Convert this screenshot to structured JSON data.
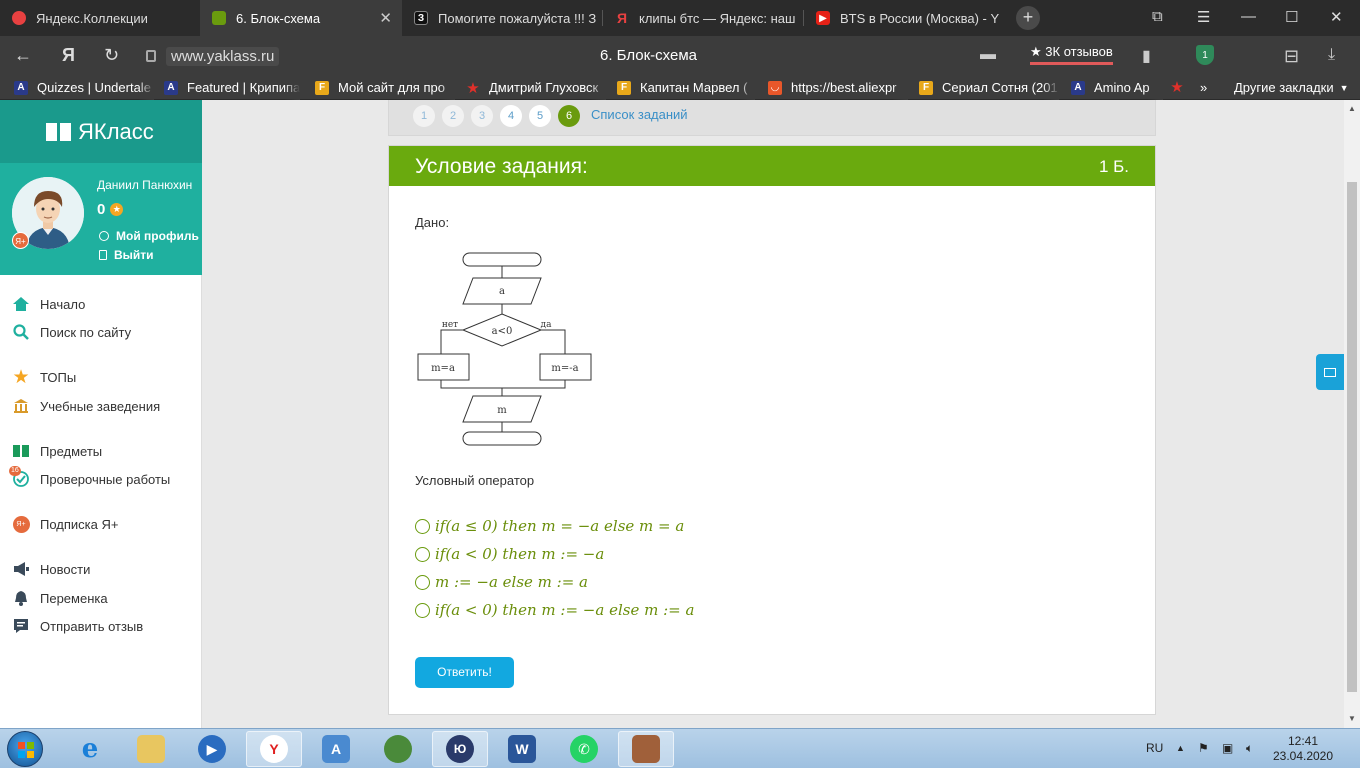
{
  "browser": {
    "tabs": [
      {
        "label": "Яндекс.Коллекции",
        "favicon_color": "#e84141"
      },
      {
        "label": "6. Блок-схема",
        "favicon_color": "#6a9b0e",
        "active": true
      },
      {
        "label": "Помогите пожалуйста !!! З",
        "favicon_text": "З"
      },
      {
        "label": "клипы бтс — Яндекс: наш",
        "favicon_text": "Я"
      },
      {
        "label": "BTS в России (Москва) - Y",
        "favicon_color": "#e62117"
      }
    ],
    "url_host": "www.yaklass.ru",
    "page_title": "6. Блок-схема",
    "reviews_label": "3К отзывов",
    "shield_count": "1",
    "bookmarks": [
      {
        "label": "Quizzes | Undertale",
        "icon": "A"
      },
      {
        "label": "Featured | Крипипа",
        "icon": "A"
      },
      {
        "label": "Мой сайт для про",
        "icon": "F"
      },
      {
        "label": "Дмитрий Глуховск",
        "icon": "star"
      },
      {
        "label": "Капитан Марвел (",
        "icon": "F"
      },
      {
        "label": "https://best.aliexpr",
        "icon": "bag"
      },
      {
        "label": "Сериал Сотня (201",
        "icon": "F"
      },
      {
        "label": "Amino Ap",
        "icon": "A"
      }
    ],
    "other_bookmarks": "Другие закладки"
  },
  "sidebar": {
    "logo": "ЯКласс",
    "user_name": "Даниил Панюхин",
    "points": "0",
    "ya_badge": "Я+",
    "my_profile": "Мой профиль",
    "logout": "Выйти",
    "menu": [
      {
        "label": "Начало",
        "icon": "home-icon"
      },
      {
        "label": "Поиск по сайту",
        "icon": "search-icon"
      },
      {
        "label": "ТОПы",
        "icon": "star-icon"
      },
      {
        "label": "Учебные заведения",
        "icon": "school-icon"
      },
      {
        "label": "Предметы",
        "icon": "book-icon"
      },
      {
        "label": "Проверочные работы",
        "icon": "check-icon",
        "badge": "16"
      },
      {
        "label": "Подписка Я+",
        "icon": "ya-plus-icon"
      },
      {
        "label": "Новости",
        "icon": "megaphone-icon"
      },
      {
        "label": "Переменка",
        "icon": "bell-icon"
      },
      {
        "label": "Отправить отзыв",
        "icon": "feedback-icon"
      }
    ]
  },
  "pager": {
    "pages": [
      "1",
      "2",
      "3",
      "4",
      "5",
      "6"
    ],
    "current": "6",
    "task_list": "Список заданий"
  },
  "task": {
    "title": "Условие задания:",
    "score": "1 Б.",
    "given": "Дано:",
    "flowchart": {
      "input": "a",
      "condition": "a<0",
      "no_label": "нет",
      "yes_label": "да",
      "left_assign": "m=a",
      "right_assign": "m=-a",
      "output": "m"
    },
    "question": "Условный оператор",
    "options": [
      "if(a ≤ 0) then m = −a  else m = a",
      "if(a < 0) then m := −a",
      "m := −a  else m := a",
      "if(a < 0) then m := −a  else m := a"
    ],
    "answer_button": "Ответить!"
  },
  "taskbar": {
    "lang": "RU",
    "time": "12:41",
    "date": "23.04.2020"
  },
  "colors": {
    "accent_green": "#6aaa0e",
    "teal": "#1fb09f",
    "button_blue": "#12a8e0"
  }
}
